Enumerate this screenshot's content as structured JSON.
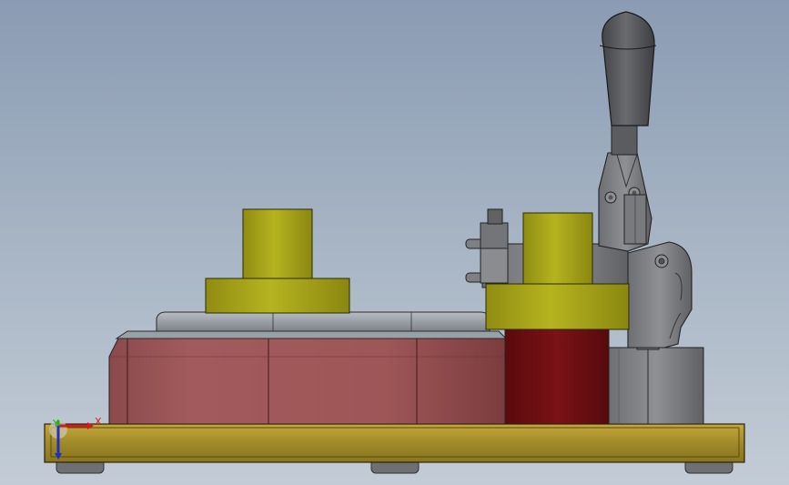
{
  "viewport": {
    "background_top": "#8a9bb3",
    "background_bottom": "#c3ccd6"
  },
  "model_colors": {
    "base_plate": "#a08a2a",
    "foot": "#707070",
    "block": "#a05a5a",
    "dark_block": "#6e0f12",
    "yellow_part": "#a8a520",
    "clamp_metal": "#808285",
    "handle": "#5a5b5e"
  },
  "triad": {
    "x_label": "X",
    "y_label": "Y",
    "x_color": "#d21c1c",
    "y_color": "#1fae2b",
    "z_color": "#1f2fbf"
  }
}
